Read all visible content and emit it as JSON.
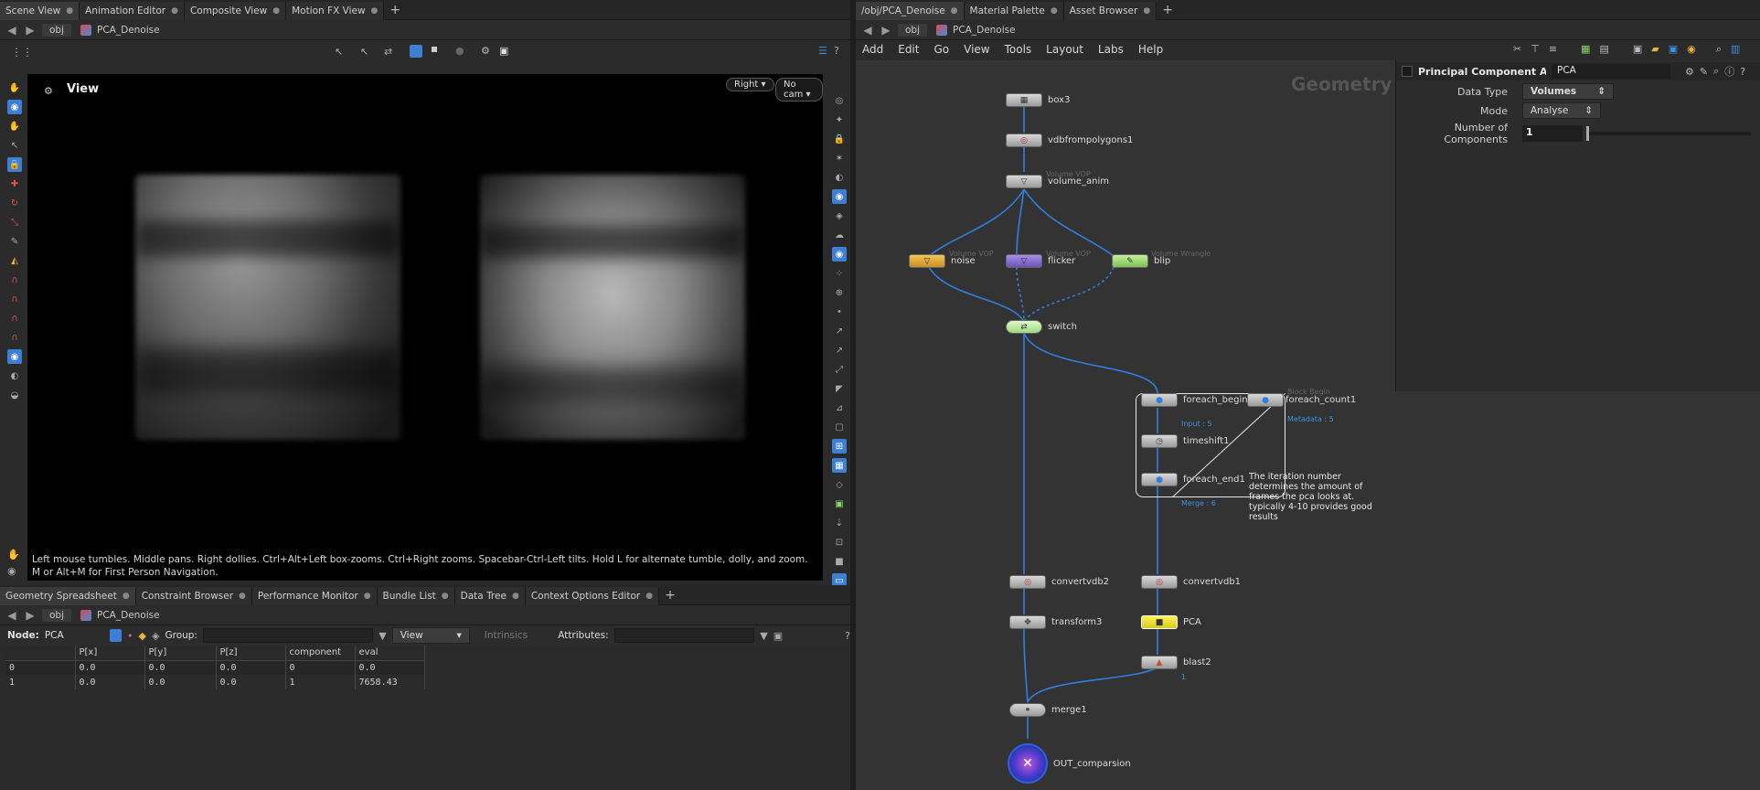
{
  "left_top_tabs": [
    {
      "label": "Scene View",
      "active": true
    },
    {
      "label": "Animation Editor",
      "active": false
    },
    {
      "label": "Composite View",
      "active": false
    },
    {
      "label": "Motion FX View",
      "active": false
    }
  ],
  "right_top_tabs": [
    {
      "label": "/obj/PCA_Denoise",
      "active": true
    },
    {
      "label": "Material Palette",
      "active": false
    },
    {
      "label": "Asset Browser",
      "active": false
    }
  ],
  "path": {
    "obj": "obj",
    "network": "PCA_Denoise"
  },
  "viewport": {
    "title": "View",
    "view_dropdown": "Right",
    "cam_dropdown": "No cam",
    "hint": "Left mouse tumbles. Middle pans. Right dollies. Ctrl+Alt+Left box-zooms. Ctrl+Right zooms. Spacebar-Ctrl-Left tilts. Hold L for alternate tumble, dolly, and zoom. M or Alt+M for First Person Navigation."
  },
  "bottom_tabs": [
    {
      "label": "Geometry Spreadsheet",
      "active": true
    },
    {
      "label": "Constraint Browser",
      "active": false
    },
    {
      "label": "Performance Monitor",
      "active": false
    },
    {
      "label": "Bundle List",
      "active": false
    },
    {
      "label": "Data Tree",
      "active": false
    },
    {
      "label": "Context Options Editor",
      "active": false
    }
  ],
  "spreadsheet": {
    "node_label": "Node:",
    "node_value": "PCA",
    "group_label": "Group:",
    "view_label": "View",
    "intrinsics_label": "Intrinsics",
    "attributes_label": "Attributes:",
    "columns": [
      "",
      "P[x]",
      "P[y]",
      "P[z]",
      "component",
      "eval"
    ],
    "rows": [
      [
        "0",
        "0.0",
        "0.0",
        "0.0",
        "0",
        "0.0"
      ],
      [
        "1",
        "0.0",
        "0.0",
        "0.0",
        "1",
        "7658.43"
      ]
    ]
  },
  "network_menu": [
    "Add",
    "Edit",
    "Go",
    "View",
    "Tools",
    "Layout",
    "Labs",
    "Help"
  ],
  "network_context": "Geometry",
  "nodes": {
    "box3": "box3",
    "vdbfrompolygons1": "vdbfrompolygons1",
    "volume_anim": "volume_anim",
    "volume_anim_sub": "Volume VOP",
    "noise": "noise",
    "noise_sub": "Volume VOP",
    "flicker": "flicker",
    "flicker_sub": "Volume VOP",
    "blip": "blip",
    "blip_sub": "Volume Wrangle",
    "switch": "switch",
    "foreach_begin1": "foreach_begin1",
    "foreach_begin1_note": "Input : 5",
    "foreach_count1": "foreach_count1",
    "foreach_count1_sub": "Block Begin",
    "foreach_count1_note": "Metadata : 5",
    "timeshift1": "timeshift1",
    "foreach_end1": "foreach_end1",
    "foreach_end1_note": "Merge : 6",
    "convertvdb2": "convertvdb2",
    "convertvdb1": "convertvdb1",
    "transform3": "transform3",
    "PCA": "PCA",
    "blast2": "blast2",
    "blast2_note": "1",
    "merge1": "merge1",
    "out": "OUT_comparsion"
  },
  "sticky_note": "The iteration number determines the amount of frames the pca looks at. typically 4-10 provides good results",
  "params": {
    "title": "Principal Component Anal...",
    "name": "PCA",
    "data_type_label": "Data Type",
    "data_type_value": "Volumes",
    "mode_label": "Mode",
    "mode_value": "Analyse",
    "num_components_label": "Number of Components",
    "num_components_value": "1"
  },
  "colors": {
    "accent": "#3e7fd6",
    "wire": "#2f7fe0",
    "noise_node": "#e8b33a",
    "flicker_node": "#8a72d8",
    "blip_node": "#a8e27a",
    "switch_node": "#c8f0a8",
    "pca_node": "#f0e030"
  }
}
